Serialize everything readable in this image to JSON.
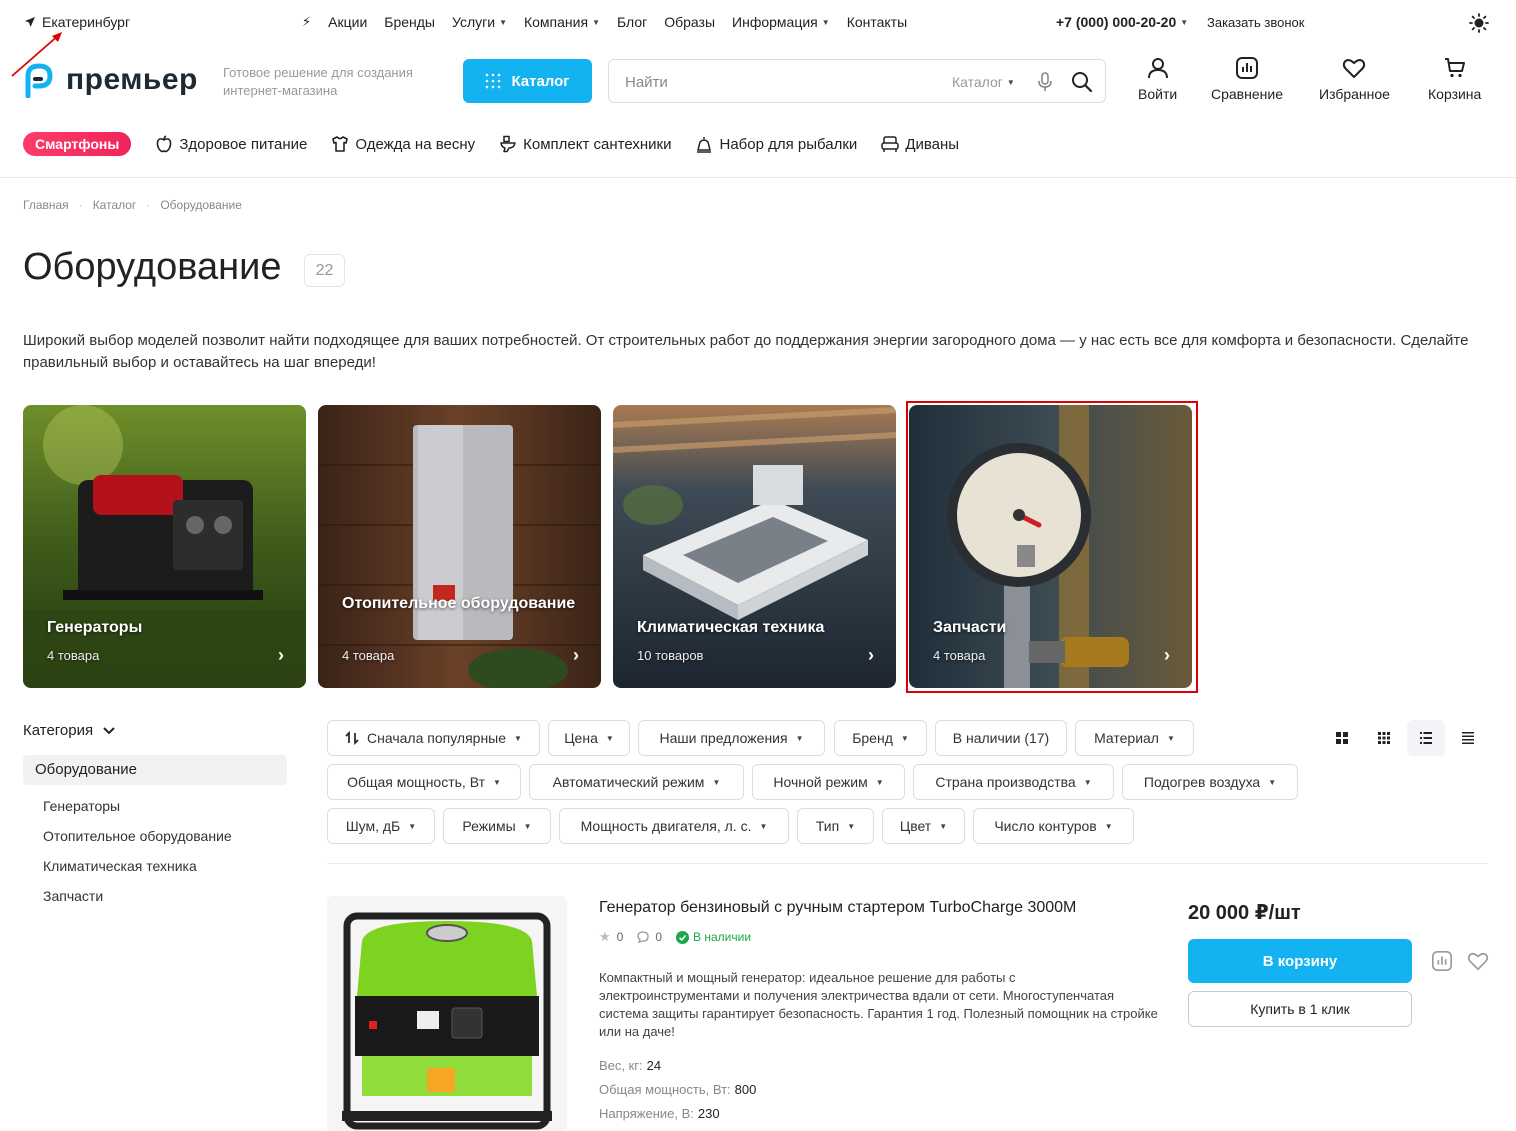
{
  "topbar": {
    "city": "Екатеринбург",
    "nav": [
      {
        "label": "Акции",
        "dropdown": false
      },
      {
        "label": "Бренды",
        "dropdown": false
      },
      {
        "label": "Услуги",
        "dropdown": true
      },
      {
        "label": "Компания",
        "dropdown": true
      },
      {
        "label": "Блог",
        "dropdown": false
      },
      {
        "label": "Образы",
        "dropdown": false
      },
      {
        "label": "Информация",
        "dropdown": true
      },
      {
        "label": "Контакты",
        "dropdown": false
      }
    ],
    "phone": "+7 (000) 000-20-20",
    "callback": "Заказать звонок"
  },
  "header": {
    "logo": "премьер",
    "tagline": "Готовое решение для создания интернет-магазина",
    "catalog_label": "Каталог",
    "search_placeholder": "Найти",
    "search_scope": "Каталог",
    "login": "Войти",
    "compare": "Сравнение",
    "favorites": "Избранное",
    "cart": "Корзина"
  },
  "quick_categories": [
    {
      "label": "Смартфоны",
      "icon": "none",
      "hot": true
    },
    {
      "label": "Здоровое питание",
      "icon": "apple-icon",
      "hot": false
    },
    {
      "label": "Одежда на весну",
      "icon": "shirt-icon",
      "hot": false
    },
    {
      "label": "Комплект сантехники",
      "icon": "toilet-icon",
      "hot": false
    },
    {
      "label": "Набор для рыбалки",
      "icon": "fishing-icon",
      "hot": false
    },
    {
      "label": "Диваны",
      "icon": "sofa-icon",
      "hot": false
    }
  ],
  "breadcrumbs": [
    "Главная",
    "Каталог",
    "Оборудование"
  ],
  "page": {
    "title": "Оборудование",
    "count": "22",
    "description": "Широкий выбор моделей позволит найти подходящее для ваших потребностей. От строительных работ до поддержания энергии загородного дома — у нас есть все для комфорта и безопасности. Сделайте правильный выбор и оставайтесь на шаг впереди!"
  },
  "tiles": [
    {
      "title": "Генераторы",
      "sub": "4 товара"
    },
    {
      "title": "Отопительное оборудование",
      "sub": "4 товара"
    },
    {
      "title": "Климатическая техника",
      "sub": "10 товаров"
    },
    {
      "title": "Запчасти",
      "sub": "4 товара"
    }
  ],
  "sidebar": {
    "heading": "Категория",
    "active": "Оборудование",
    "items": [
      "Генераторы",
      "Отопительное оборудование",
      "Климатическая техника",
      "Запчасти"
    ]
  },
  "filters": {
    "sort": "Сначала популярные",
    "row1": [
      "Цена",
      "Наши предложения",
      "Бренд",
      "В наличии (17)",
      "Материал"
    ],
    "row2": [
      "Общая мощность, Вт",
      "Автоматический режим",
      "Ночной режим",
      "Страна производства",
      "Подогрев воздуха"
    ],
    "row3": [
      "Шум, дБ",
      "Режимы",
      "Мощность двигателя, л. с.",
      "Тип",
      "Цвет",
      "Число контуров"
    ]
  },
  "product": {
    "title": "Генератор бензиновый с ручным стартером TurboCharge 3000M",
    "rating": "0",
    "reviews": "0",
    "stock": "В наличии",
    "description": "Компактный и мощный генератор: идеальное решение для работы с электроинструментами и получения электричества вдали от сети. Многоступенчатая система защиты гарантирует безопасность. Гарантия 1 год. Полезный помощник на стройке или на даче!",
    "specs": [
      {
        "label": "Вес, кг:",
        "value": "24"
      },
      {
        "label": "Общая мощность, Вт:",
        "value": "800"
      },
      {
        "label": "Напряжение, В:",
        "value": "230"
      }
    ],
    "price": "20 000 ₽/шт",
    "cart_label": "В корзину",
    "oneclick_label": "Купить в 1 клик"
  },
  "colors": {
    "accent": "#12b3f0",
    "hot": "#f0245a",
    "stock": "#1fa64a",
    "highlight": "#e00000"
  }
}
